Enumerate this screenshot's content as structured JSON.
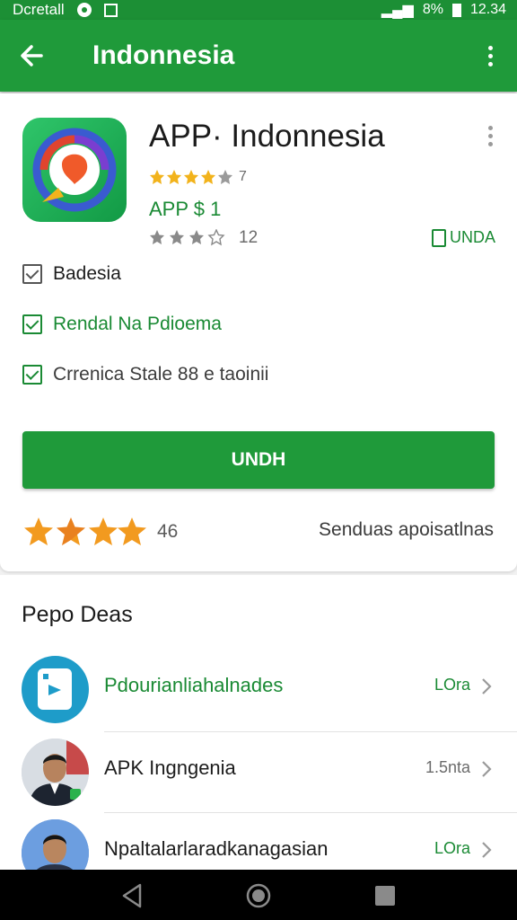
{
  "status_bar": {
    "left_text": "Dcretall",
    "right_text": "12.34",
    "battery_text": "8%"
  },
  "app_bar": {
    "title": "Indonnesia"
  },
  "app": {
    "name": "APP· Indonnesia",
    "rating_count": "7",
    "price": "APP $ 1",
    "gray_rating_count": "12",
    "tag_label": "UNDA",
    "checks": [
      {
        "label": "Badesia",
        "checked": true
      },
      {
        "label": "Rendal Na Pdioema",
        "checked": true
      },
      {
        "label": "Crrenica Stale 88 e taoinii",
        "checked": true
      }
    ],
    "install_label": "UNDH",
    "stars_count": "46",
    "right_caption": "Senduas apoisatlnas"
  },
  "section": {
    "title": "Pepo Deas",
    "items": [
      {
        "name": "Pdourianliahalnades",
        "meta": "LOra",
        "meta_color": "green"
      },
      {
        "name": "APK Ingngenia",
        "meta": "1.5nta",
        "meta_color": "gray"
      },
      {
        "name": "Npaltalarlaradkanagasian",
        "meta": "LOra",
        "meta_color": "green"
      }
    ]
  },
  "colors": {
    "primary": "#1f9a3a",
    "status_bar": "#1c8f35",
    "accent_text": "#1a8a34",
    "star": "#f29a1f"
  }
}
